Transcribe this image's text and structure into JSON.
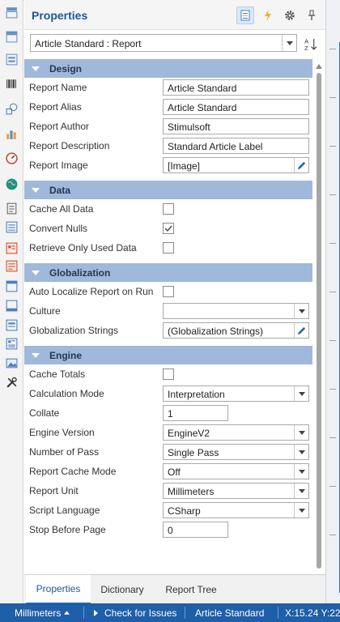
{
  "panel": {
    "title": "Properties"
  },
  "header_buttons": [
    {
      "icon": "properties-icon",
      "active": true
    },
    {
      "icon": "events-icon"
    },
    {
      "icon": "gear-icon"
    },
    {
      "icon": "pin-icon"
    }
  ],
  "object_selector": {
    "value": "Article Standard : Report"
  },
  "categories": {
    "design": {
      "label": "Design",
      "rows": {
        "report_name": {
          "label": "Report Name",
          "value": "Article Standard"
        },
        "report_alias": {
          "label": "Report Alias",
          "value": "Article Standard"
        },
        "report_author": {
          "label": "Report Author",
          "value": "Stimulsoft"
        },
        "report_description": {
          "label": "Report Description",
          "value": "Standard Article Label"
        },
        "report_image": {
          "label": "Report Image",
          "value": "[Image]"
        }
      }
    },
    "data": {
      "label": "Data",
      "rows": {
        "cache_all_data": {
          "label": "Cache All Data",
          "checked": false
        },
        "convert_nulls": {
          "label": "Convert Nulls",
          "checked": true
        },
        "retrieve_only_used_data": {
          "label": "Retrieve Only Used Data",
          "checked": false
        }
      }
    },
    "globalization": {
      "label": "Globalization",
      "rows": {
        "auto_localize": {
          "label": "Auto Localize Report on Run",
          "checked": false
        },
        "culture": {
          "label": "Culture",
          "value": ""
        },
        "globalization_strings": {
          "label": "Globalization Strings",
          "value": "(Globalization Strings)"
        }
      }
    },
    "engine": {
      "label": "Engine",
      "rows": {
        "cache_totals": {
          "label": "Cache Totals",
          "checked": false
        },
        "calculation_mode": {
          "label": "Calculation Mode",
          "value": "Interpretation"
        },
        "collate": {
          "label": "Collate",
          "value": "1"
        },
        "engine_version": {
          "label": "Engine Version",
          "value": "EngineV2"
        },
        "number_of_pass": {
          "label": "Number of Pass",
          "value": "Single Pass"
        },
        "report_cache_mode": {
          "label": "Report Cache Mode",
          "value": "Off"
        },
        "report_unit": {
          "label": "Report Unit",
          "value": "Millimeters"
        },
        "script_language": {
          "label": "Script Language",
          "value": "CSharp"
        },
        "stop_before_page": {
          "label": "Stop Before Page",
          "value": "0"
        }
      }
    }
  },
  "tabs": [
    {
      "label": "Properties",
      "active": true
    },
    {
      "label": "Dictionary"
    },
    {
      "label": "Report Tree"
    }
  ],
  "status_bar": {
    "units": "Millimeters",
    "check_issues": "Check for Issues",
    "report_name": "Article Standard",
    "coords": "X:15.24 Y:22"
  },
  "colors": {
    "accent": "#1e5799",
    "category_band": "#a0b8d9",
    "status_bar": "#1f5ea8"
  }
}
